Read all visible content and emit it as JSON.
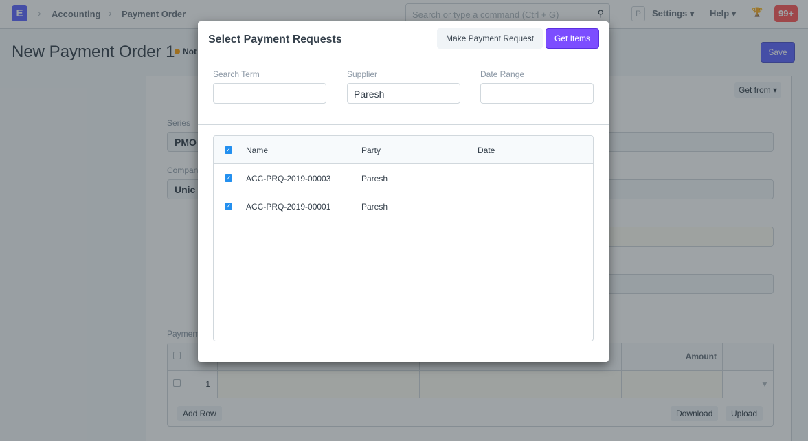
{
  "navbar": {
    "logo": "E",
    "breadcrumbs": [
      "Accounting",
      "Payment Order"
    ],
    "search_placeholder": "Search or type a command (Ctrl + G)",
    "avatar": "P",
    "settings": "Settings",
    "help": "Help",
    "notifications": "99+"
  },
  "page": {
    "title": "New Payment Order 1",
    "status": "Not Saved",
    "save": "Save",
    "get_from": "Get from"
  },
  "form": {
    "series_label": "Series",
    "series_value": "PMO",
    "company_label": "Company",
    "company_value": "Unic",
    "table_label": "Payment",
    "amount_header": "Amount",
    "row_no": "1",
    "add_row": "Add Row",
    "download": "Download",
    "upload": "Upload"
  },
  "modal": {
    "title": "Select Payment Requests",
    "make_payment_request": "Make Payment Request",
    "get_items": "Get Items",
    "filters": {
      "search_term_label": "Search Term",
      "search_term_value": "",
      "supplier_label": "Supplier",
      "supplier_value": "Paresh",
      "date_range_label": "Date Range",
      "date_range_value": ""
    },
    "columns": [
      "Name",
      "Party",
      "Date"
    ],
    "rows": [
      {
        "name": "ACC-PRQ-2019-00003",
        "party": "Paresh",
        "date": "",
        "checked": true
      },
      {
        "name": "ACC-PRQ-2019-00001",
        "party": "Paresh",
        "date": "",
        "checked": true
      }
    ]
  },
  "colors": {
    "brand": "#5e64ff",
    "primary_button": "#7c4dff",
    "checkbox": "#2490ef",
    "badge": "#ff5858"
  }
}
